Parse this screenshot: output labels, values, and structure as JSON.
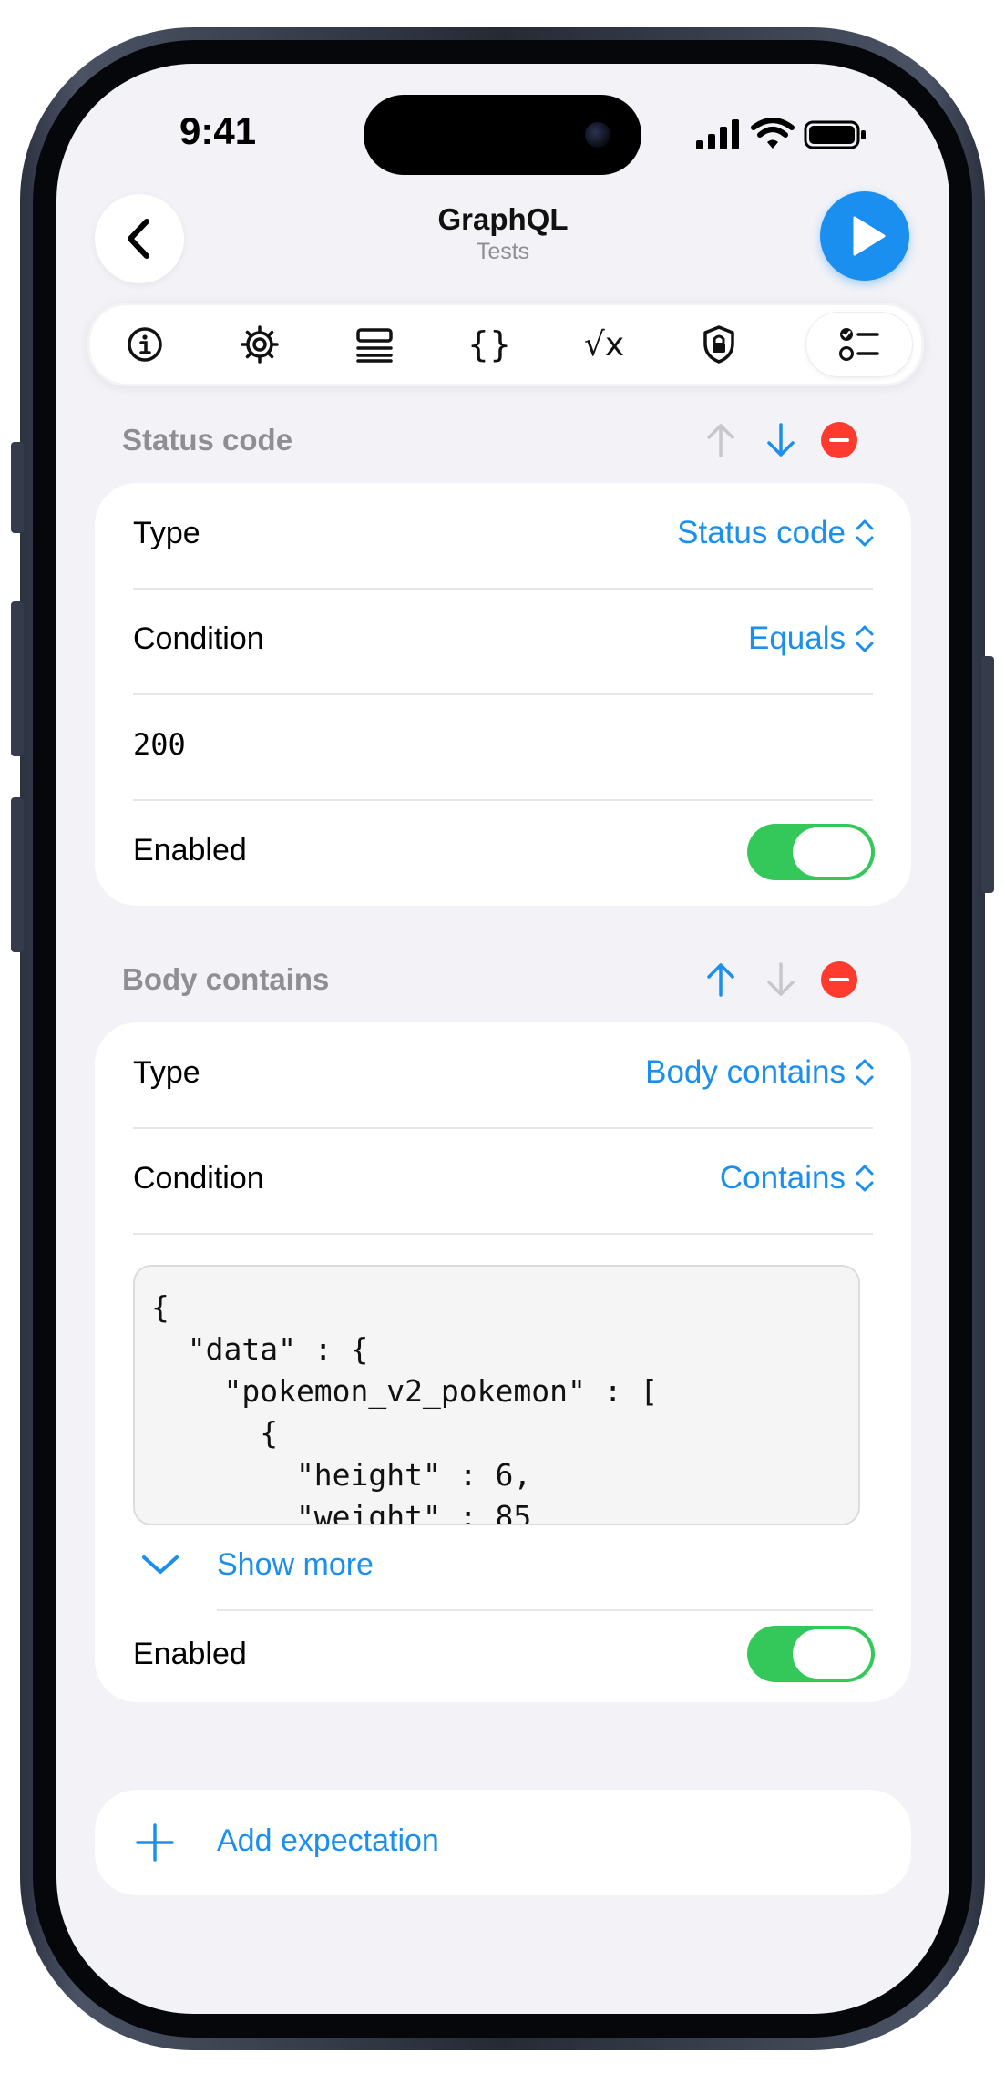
{
  "status_bar": {
    "time": "9:41"
  },
  "nav": {
    "title": "GraphQL",
    "subtitle": "Tests"
  },
  "tabs": [
    {
      "name": "info-icon"
    },
    {
      "name": "gear-icon"
    },
    {
      "name": "list-icon"
    },
    {
      "name": "braces-icon",
      "glyph": "{}"
    },
    {
      "name": "sqrt-x-icon",
      "glyph": "√x"
    },
    {
      "name": "shield-lock-icon"
    },
    {
      "name": "checklist-icon",
      "active": true
    }
  ],
  "expectations": [
    {
      "header": "Status code",
      "type_label": "Type",
      "type_value": "Status code",
      "condition_label": "Condition",
      "condition_value": "Equals",
      "value": "200",
      "enabled_label": "Enabled",
      "enabled": true
    },
    {
      "header": "Body contains",
      "type_label": "Type",
      "type_value": "Body contains",
      "condition_label": "Condition",
      "condition_value": "Contains",
      "code": "{\n  \"data\" : {\n    \"pokemon_v2_pokemon\" : [\n      {\n        \"height\" : 6,\n        \"weight\" : 85",
      "show_more": "Show more",
      "enabled_label": "Enabled",
      "enabled": true
    }
  ],
  "add_expectation": "Add expectation",
  "colors": {
    "accent": "#1a8fef",
    "toggle_on": "#34c759",
    "delete": "#ff3b30",
    "background": "#f2f2f7"
  }
}
